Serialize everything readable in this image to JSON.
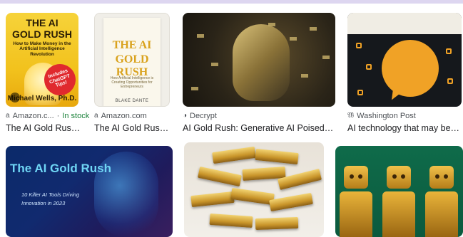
{
  "colors": {
    "top_accent": "#ddd6f0",
    "instock_green": "#188038",
    "source_gray": "#4d5156",
    "title_text": "#202124"
  },
  "results": [
    {
      "source": "Amazon.c...",
      "stock": "In stock",
      "title": "The AI Gold Rush: H...",
      "source_icon": "amazon-icon",
      "cover": {
        "title_line1": "THE AI",
        "title_line2": "GOLD RUSH",
        "subtitle": "How to Make Money in the Artificial Intelligence Revolution",
        "badge": "Includes ChatGPT Tips!",
        "author": "Michael Wells, Ph.D."
      }
    },
    {
      "source": "Amazon.com",
      "title": "The AI Gold Rush: H...",
      "source_icon": "amazon-icon",
      "cover": {
        "title_line1": "THE AI",
        "title_line2": "GOLD RUSH",
        "subtitle": "How Artificial Intelligence is Creating Opportunities for Entrepreneurs",
        "author": "BLAKE DANTE"
      }
    },
    {
      "source": "Decrypt",
      "title": "AI Gold Rush: Generative AI Poised to ...",
      "source_icon": "decrypt-icon"
    },
    {
      "source": "Washington Post",
      "title": "AI technology that may be co...",
      "source_icon": "washington-post-icon"
    },
    {
      "cover": {
        "title": "The AI Gold Rush",
        "subtitle_line1": "10 Killer AI Tools Driving",
        "subtitle_line2": "Innovation in 2023"
      }
    },
    {},
    {}
  ]
}
